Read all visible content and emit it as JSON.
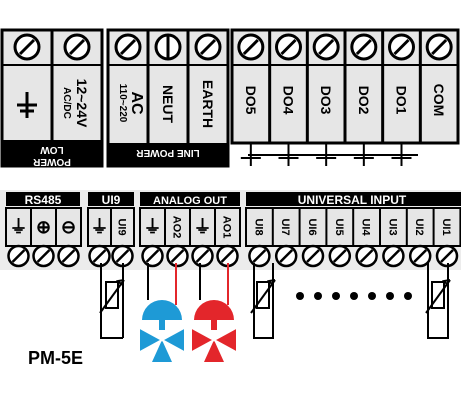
{
  "colors": {
    "background": "#ffffff",
    "panel": "#e6e6e6",
    "band": "#ececec",
    "black": "#000000",
    "cold_valve": "#1e9ad6",
    "hot_valve": "#e3262b"
  },
  "low_power": {
    "label_line1": "LOW",
    "label_line2": "POWER",
    "terminals": [
      {
        "label": "⏚"
      },
      {
        "label_line1": "12~24V",
        "label_line2": "AC/DC"
      }
    ]
  },
  "line_power": {
    "label": "LINE POWER",
    "terminals": [
      {
        "label_line1": "AC",
        "label_line2": "110~220"
      },
      {
        "label": "NEUT"
      },
      {
        "label": "EARTH"
      }
    ]
  },
  "relay_outputs": {
    "terminals": [
      "DO5",
      "DO4",
      "DO3",
      "DO2",
      "DO1",
      "COM"
    ]
  },
  "groups": {
    "rs485": {
      "label": "RS485",
      "terminals": [
        "⏚",
        "⊕",
        "⊖"
      ]
    },
    "ui9": {
      "label": "UI9",
      "terminals": [
        "⏚",
        "UI9"
      ]
    },
    "analog_out": {
      "label": "ANALOG OUT",
      "terminals": [
        "⏚",
        "AO2",
        "⏚",
        "AO1"
      ]
    },
    "universal_input": {
      "label": "UNIVERSAL INPUT",
      "terminals": [
        "UI8",
        "UI7",
        "UI6",
        "UI5",
        "UI4",
        "UI3",
        "UI2",
        "UI1"
      ]
    }
  },
  "model": "PM-5E"
}
